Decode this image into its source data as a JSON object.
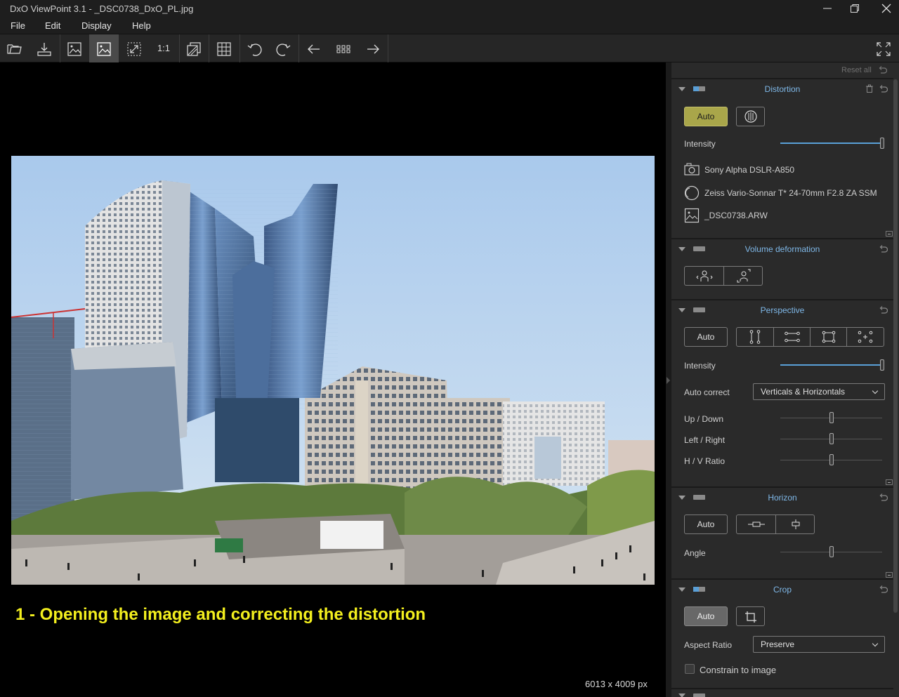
{
  "window": {
    "title": "DxO ViewPoint 3.1 - _DSC0738_DxO_PL.jpg"
  },
  "menu": [
    "File",
    "Edit",
    "Display",
    "Help"
  ],
  "toolbar": {
    "items": [
      "open-folder-icon",
      "export-icon",
      "compare-icon",
      "single-view-icon",
      "fit-screen-icon",
      "zoom-100",
      "before-after-icon",
      "grid-icon",
      "rotate-left-icon",
      "rotate-right-icon",
      "previous-icon",
      "thumbnails-icon",
      "next-icon",
      "fullscreen-icon"
    ],
    "zoom_label": "1:1",
    "active": "single-view-icon"
  },
  "viewer": {
    "caption": "1 - Opening the image and correcting the distortion",
    "dimensions": "6013 x 4009 px"
  },
  "panel": {
    "reset_all": "Reset all",
    "distortion": {
      "title": "Distortion",
      "auto_label": "Auto",
      "intensity_label": "Intensity",
      "intensity_value": 1.0,
      "camera": "Sony Alpha DSLR-A850",
      "lens": "Zeiss Vario-Sonnar T* 24-70mm F2.8 ZA SSM",
      "file": "_DSC0738.ARW"
    },
    "volume": {
      "title": "Volume deformation"
    },
    "perspective": {
      "title": "Perspective",
      "auto_label": "Auto",
      "intensity_label": "Intensity",
      "intensity_value": 1.0,
      "auto_correct_label": "Auto correct",
      "auto_correct_value": "Verticals & Horizontals",
      "updown_label": "Up / Down",
      "updown_value": 0.5,
      "leftright_label": "Left / Right",
      "leftright_value": 0.5,
      "hv_label": "H / V Ratio",
      "hv_value": 0.5
    },
    "horizon": {
      "title": "Horizon",
      "auto_label": "Auto",
      "angle_label": "Angle",
      "angle_value": 0.5
    },
    "crop": {
      "title": "Crop",
      "auto_label": "Auto",
      "aspect_label": "Aspect Ratio",
      "aspect_value": "Preserve",
      "constrain_label": "Constrain to image",
      "constrain_checked": false
    }
  },
  "colors": {
    "accent": "#7fb8e8",
    "auto_active": "#a9a64a",
    "caption": "#f3ef1e"
  }
}
